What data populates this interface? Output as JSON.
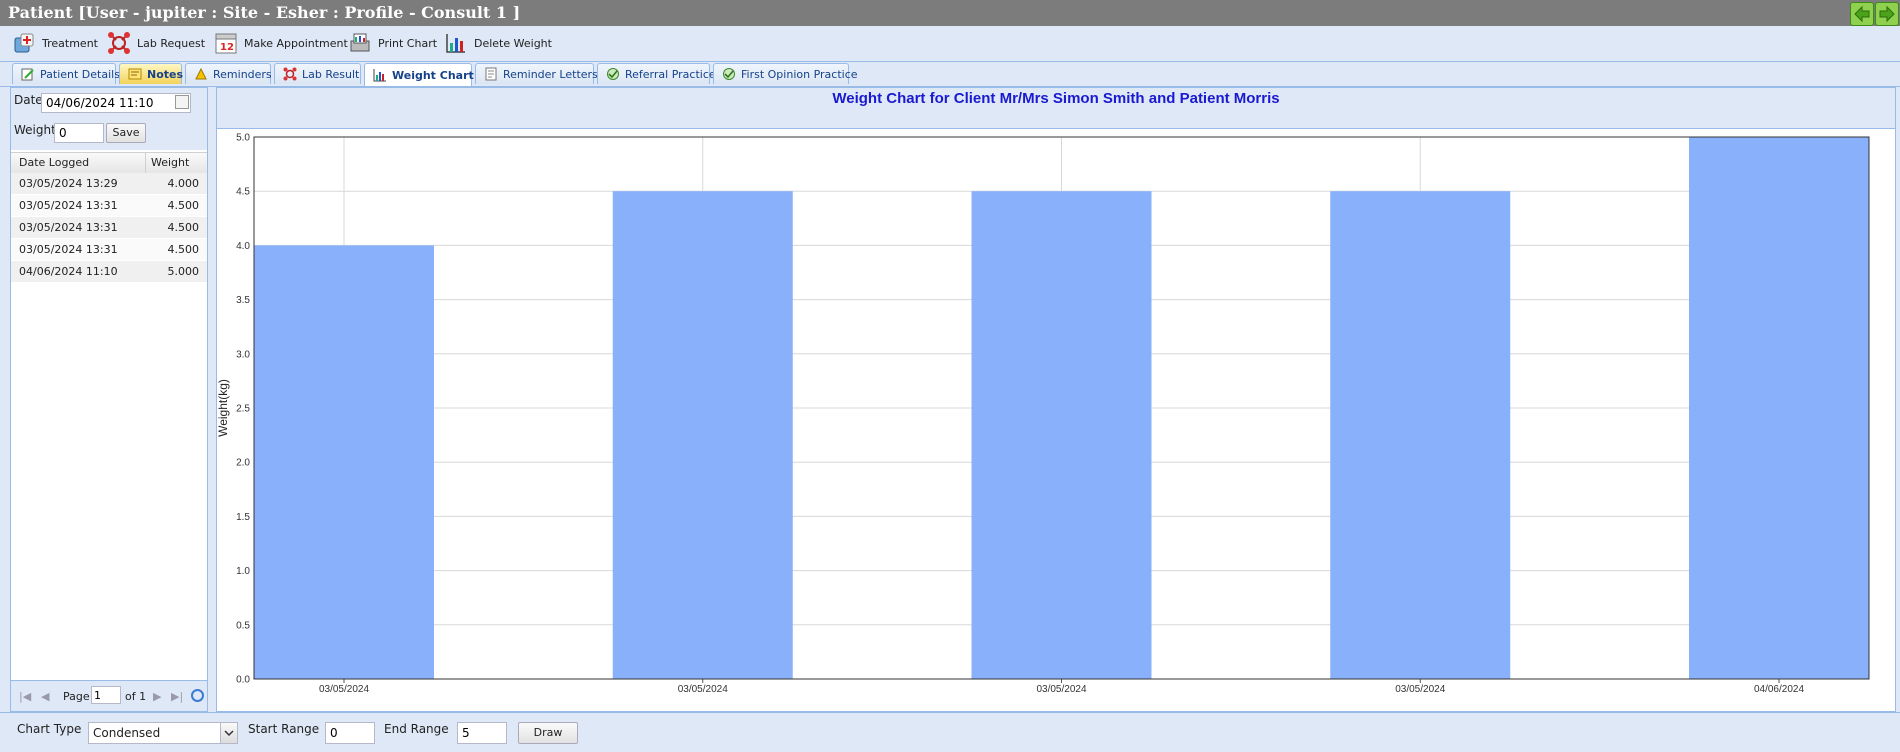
{
  "window": {
    "title": "Patient [User - jupiter : Site - Esher : Profile - Consult 1 ]"
  },
  "toolbar": {
    "treatment": "Treatment",
    "lab_request": "Lab Request",
    "make_appointment": "Make Appointment",
    "print_chart": "Print Chart",
    "delete_weight": "Delete Weight",
    "appointment_icon_text": "12"
  },
  "tabs": [
    {
      "label": "Patient Details"
    },
    {
      "label": "Notes"
    },
    {
      "label": "Reminders"
    },
    {
      "label": "Lab Result"
    },
    {
      "label": "Weight Chart"
    },
    {
      "label": "Reminder Letters"
    },
    {
      "label": "Referral Practice"
    },
    {
      "label": "First Opinion Practice"
    }
  ],
  "form": {
    "date_label": "Date",
    "date_value": "04/06/2024 11:10",
    "weight_label": "Weight",
    "weight_value": "0",
    "save_label": "Save"
  },
  "grid": {
    "headers": [
      "Date Logged",
      "Weight"
    ],
    "rows": [
      {
        "date": "03/05/2024 13:29",
        "weight": "4.000"
      },
      {
        "date": "03/05/2024 13:31",
        "weight": "4.500"
      },
      {
        "date": "03/05/2024 13:31",
        "weight": "4.500"
      },
      {
        "date": "03/05/2024 13:31",
        "weight": "4.500"
      },
      {
        "date": "04/06/2024 11:10",
        "weight": "5.000"
      }
    ]
  },
  "pager": {
    "page_label": "Page",
    "page_value": "1",
    "of_label": "of 1"
  },
  "chart_title": "Weight Chart for Client Mr/Mrs Simon Smith and Patient Morris",
  "chart_data": {
    "type": "bar",
    "categories": [
      "03/05/2024",
      "03/05/2024",
      "03/05/2024",
      "03/05/2024",
      "04/06/2024"
    ],
    "values": [
      4.0,
      4.5,
      4.5,
      4.5,
      5.0
    ],
    "title": "Weight Chart for Client Mr/Mrs Simon Smith and Patient Morris",
    "xlabel": "",
    "ylabel": "Weight(kg)",
    "ylim": [
      0,
      5
    ],
    "yticks": [
      "0.0",
      "0.5",
      "1.0",
      "1.5",
      "2.0",
      "2.5",
      "3.0",
      "3.5",
      "4.0",
      "4.5",
      "5.0"
    ],
    "grid": true,
    "bar_color": "#88b0fb"
  },
  "bottom": {
    "chart_type_label": "Chart Type",
    "chart_type_value": "Condensed",
    "start_range_label": "Start Range",
    "start_range_value": "0",
    "end_range_label": "End Range",
    "end_range_value": "5",
    "draw_label": "Draw"
  }
}
